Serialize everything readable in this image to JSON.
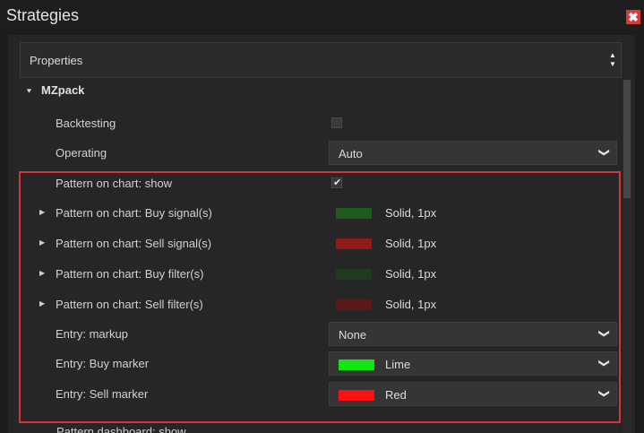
{
  "window": {
    "title": "Strategies",
    "close_symbol": "✖"
  },
  "properties": {
    "header_label": "Properties",
    "scroll_up": "▲",
    "scroll_down": "▼"
  },
  "group": {
    "name": "MZpack",
    "expanded_glyph": "▼",
    "collapsed_glyph": "▶"
  },
  "rows": {
    "backtesting": {
      "label": "Backtesting",
      "checked": false
    },
    "operating": {
      "label": "Operating",
      "value": "Auto"
    },
    "pattern_show": {
      "label": "Pattern on chart: show",
      "checked": true,
      "check_glyph": "✔"
    },
    "buy_signals": {
      "label": "Pattern on chart: Buy signal(s)",
      "value": "Solid, 1px",
      "color": "#1f5a1f"
    },
    "sell_signals": {
      "label": "Pattern on chart: Sell signal(s)",
      "value": "Solid, 1px",
      "color": "#8f1b1b"
    },
    "buy_filters": {
      "label": "Pattern on chart: Buy filter(s)",
      "value": "Solid, 1px",
      "color": "#1f3c1f"
    },
    "sell_filters": {
      "label": "Pattern on chart: Sell filter(s)",
      "value": "Solid, 1px",
      "color": "#5a1a1a"
    },
    "entry_markup": {
      "label": "Entry: markup",
      "value": "None"
    },
    "buy_marker": {
      "label": "Entry: Buy marker",
      "value": "Lime",
      "color": "#11e611"
    },
    "sell_marker": {
      "label": "Entry: Sell marker",
      "value": "Red",
      "color": "#ff1010"
    },
    "dashboard_show": {
      "label": "Pattern dashboard: show"
    }
  },
  "chevron": "❯",
  "colors": {
    "highlight": "#d0363b",
    "close": "#d83a3a"
  }
}
